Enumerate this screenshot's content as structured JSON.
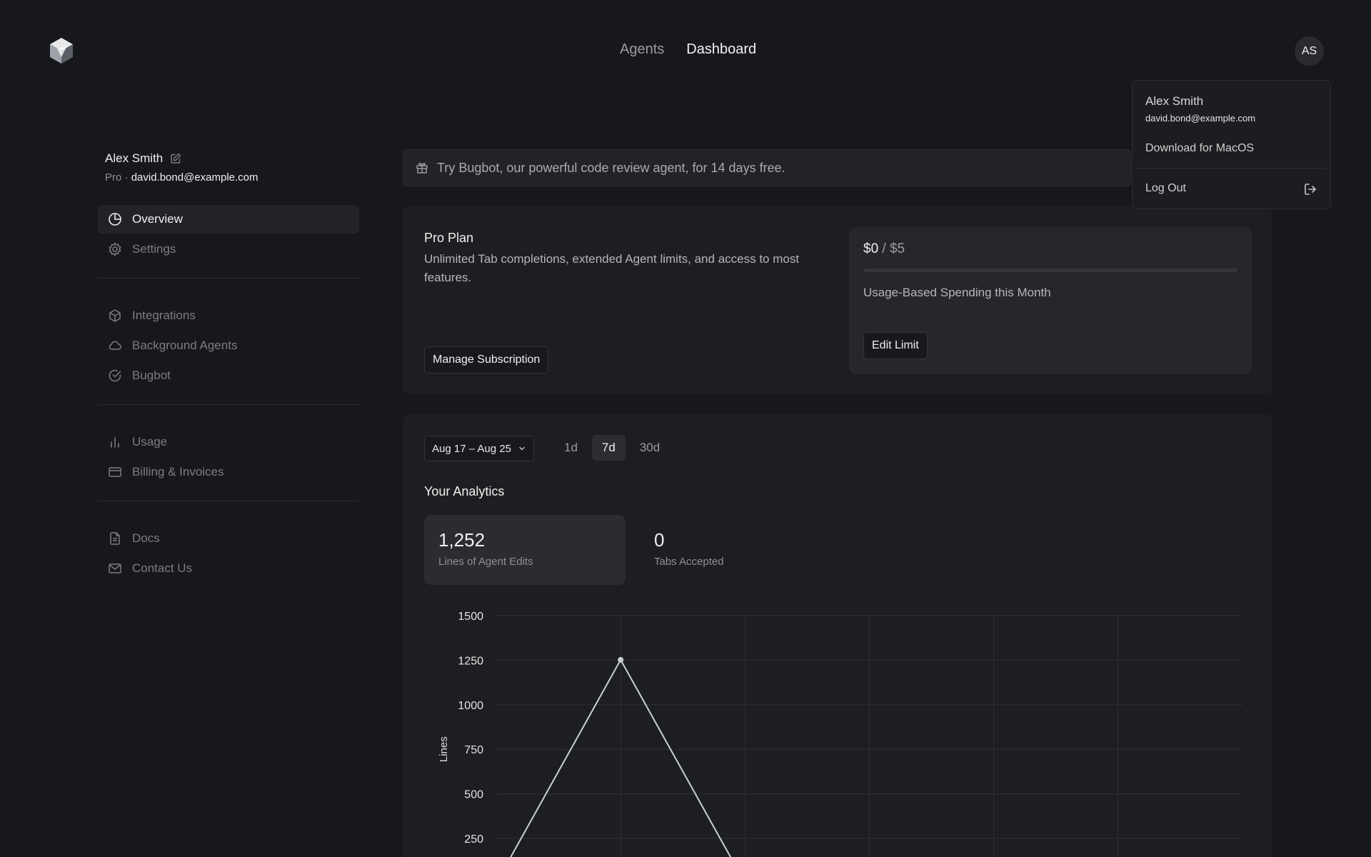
{
  "topnav": {
    "agents": "Agents",
    "dashboard": "Dashboard"
  },
  "avatar": {
    "initials": "AS"
  },
  "dropdown": {
    "name": "Alex Smith",
    "email": "david.bond@example.com",
    "download": "Download for MacOS",
    "logout": "Log Out"
  },
  "profile": {
    "name": "Alex Smith",
    "plan": "Pro",
    "separator": "·",
    "email": "david.bond@example.com"
  },
  "sidebar": {
    "items": [
      {
        "label": "Overview",
        "icon": "pie-chart-icon"
      },
      {
        "label": "Settings",
        "icon": "gear-icon"
      },
      {
        "label": "Integrations",
        "icon": "cube-icon"
      },
      {
        "label": "Background Agents",
        "icon": "cloud-icon"
      },
      {
        "label": "Bugbot",
        "icon": "check-circle-icon"
      },
      {
        "label": "Usage",
        "icon": "bar-chart-icon"
      },
      {
        "label": "Billing & Invoices",
        "icon": "credit-card-icon"
      },
      {
        "label": "Docs",
        "icon": "document-icon"
      },
      {
        "label": "Contact Us",
        "icon": "mail-icon"
      }
    ]
  },
  "banner": {
    "text": "Try Bugbot, our powerful code review agent, for 14 days free.",
    "icon": "gift-icon"
  },
  "plan": {
    "title": "Pro Plan",
    "description": "Unlimited Tab completions, extended Agent limits, and access to most features.",
    "manage_label": "Manage Subscription"
  },
  "usage": {
    "spent": "$0",
    "separator": " / ",
    "limit": "$5",
    "fraction": 0,
    "label": "Usage-Based Spending this Month",
    "edit_label": "Edit Limit"
  },
  "analytics": {
    "date_range": "Aug 17 – Aug 25",
    "ranges": [
      "1d",
      "7d",
      "30d"
    ],
    "active_range": "7d",
    "title": "Your Analytics",
    "metrics": [
      {
        "value": "1,252",
        "label": "Lines of Agent Edits"
      },
      {
        "value": "0",
        "label": "Tabs Accepted"
      }
    ]
  },
  "chart_data": {
    "type": "line",
    "ylabel": "Lines",
    "yticks": [
      250,
      500,
      750,
      1000,
      1250,
      1500
    ],
    "ylim": [
      0,
      1500
    ],
    "x_count": 6,
    "series": [
      {
        "values": [
          0,
          1252,
          0,
          0,
          0,
          0
        ]
      }
    ],
    "grid": true,
    "line_color": "#c8d0d4"
  }
}
